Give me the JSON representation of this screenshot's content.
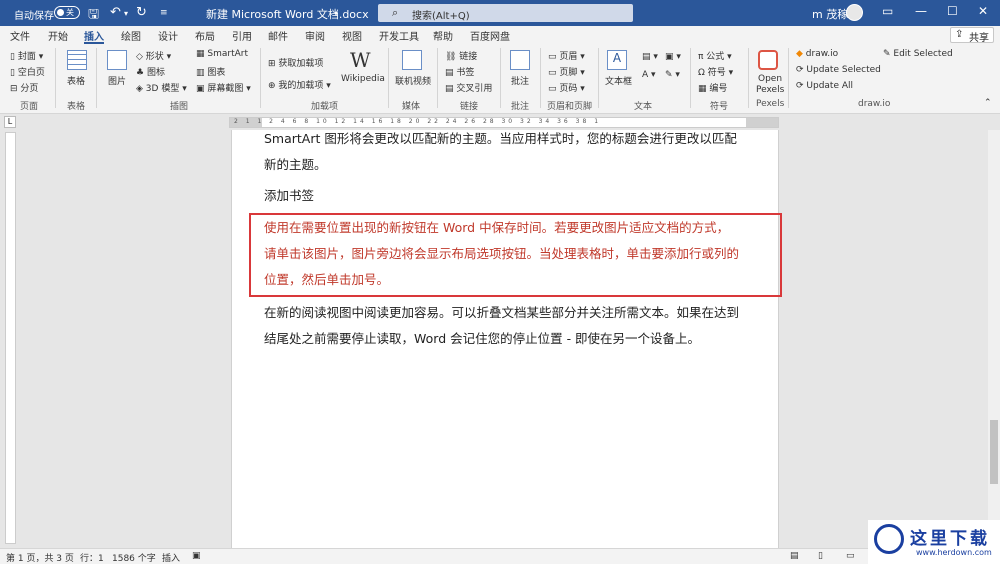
{
  "titlebar": {
    "autosave_label": "自动保存",
    "autosave_state": "关",
    "doc_title": "新建 Microsoft Word 文档.docx",
    "search_placeholder": "搜索(Alt+Q)",
    "user_name": "m 茂稼"
  },
  "tabs": [
    "文件",
    "开始",
    "插入",
    "绘图",
    "设计",
    "布局",
    "引用",
    "邮件",
    "审阅",
    "视图",
    "开发工具",
    "帮助",
    "百度网盘"
  ],
  "active_tab": "插入",
  "share_label": "共享",
  "ribbon": {
    "pages": {
      "cover": "封面",
      "blank": "空白页",
      "break": "分页",
      "group": "页面"
    },
    "tables": {
      "table": "表格",
      "group": "表格"
    },
    "illustrations": {
      "picture": "图片",
      "shapes": "形状",
      "icons": "图标",
      "models": "3D 模型",
      "smartart": "SmartArt",
      "chart": "图表",
      "screenshot": "屏幕截图",
      "group": "插图"
    },
    "addins": {
      "get": "获取加载项",
      "mine": "我的加载项",
      "wiki": "Wikipedia",
      "group": "加载项"
    },
    "media": {
      "video": "联机视频",
      "group": "媒体"
    },
    "links": {
      "link": "链接",
      "bookmark": "书签",
      "crossref": "交叉引用",
      "group": "链接"
    },
    "comments": {
      "comment": "批注",
      "group": "批注"
    },
    "header_footer": {
      "header": "页眉",
      "footer": "页脚",
      "pagenum": "页码",
      "group": "页眉和页脚"
    },
    "text": {
      "textbox": "文本框",
      "group": "文本"
    },
    "symbols": {
      "equation": "公式",
      "symbol": "符号",
      "number": "编号",
      "group": "符号"
    },
    "pexels": {
      "open": "Open",
      "pexels": "Pexels",
      "group": "Pexels"
    },
    "drawio": {
      "drawio": "draw.io",
      "update_selected": "Update Selected",
      "update_all": "Update All",
      "edit_selected": "Edit Selected",
      "group": "draw.io"
    }
  },
  "ruler_numbers": "2 1 1 2 4 6 8 10 12 14 16 18 20 22 24 26 28 30 32 34 36 38 1",
  "document": {
    "line1": "SmartArt  图形将会更改以匹配新的主题。当应用样式时，您的标题会进行更改以匹配",
    "line2": "新的主题。",
    "line3": "添加书签",
    "red1": "使用在需要位置出现的新按钮在  Word  中保存时间。若要更改图片适应文档的方式，",
    "red2": "请单击该图片，图片旁边将会显示布局选项按钮。当处理表格时，单击要添加行或列的",
    "red3": "位置，然后单击加号。",
    "line4": "在新的阅读视图中阅读更加容易。可以折叠文档某些部分并关注所需文本。如果在达到",
    "line5": "结尾处之前需要停止读取，Word  会记住您的停止位置  -  即使在另一个设备上。"
  },
  "status": {
    "page": "第 1 页，共 3 页",
    "line": "行：1",
    "words": "1586 个字",
    "mode": "插入"
  },
  "watermark": {
    "text": "这里下载",
    "url": "www.herdown.com"
  },
  "colors": {
    "titlebar": "#2b579a",
    "highlight": "#d9383a",
    "red_text": "#c0392b"
  }
}
